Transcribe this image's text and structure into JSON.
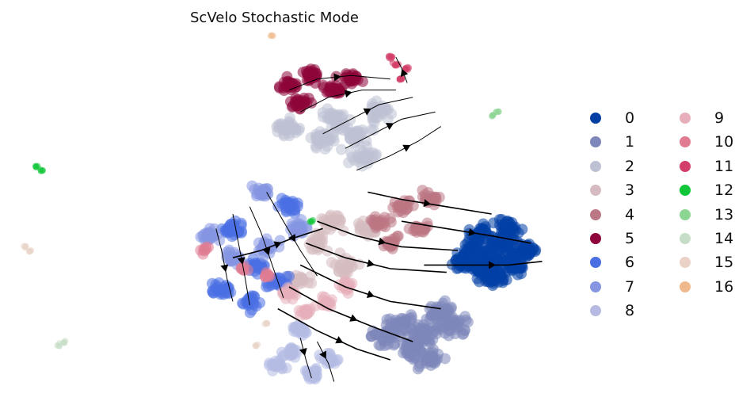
{
  "chart_data": {
    "type": "scatter",
    "title": "ScVelo Stochastic Mode",
    "xlabel": "",
    "ylabel": "",
    "grid": false,
    "legend_position": "right",
    "legend_entries": [
      {
        "label": "0",
        "color": "#023fa5"
      },
      {
        "label": "1",
        "color": "#7d87b9"
      },
      {
        "label": "2",
        "color": "#bec1d4"
      },
      {
        "label": "3",
        "color": "#d6bcc0"
      },
      {
        "label": "4",
        "color": "#bb7784"
      },
      {
        "label": "5",
        "color": "#8e063b"
      },
      {
        "label": "6",
        "color": "#4a6fe3"
      },
      {
        "label": "7",
        "color": "#8595e1"
      },
      {
        "label": "8",
        "color": "#b5bbe3"
      },
      {
        "label": "9",
        "color": "#e6afb9"
      },
      {
        "label": "10",
        "color": "#e07b91"
      },
      {
        "label": "11",
        "color": "#d33f6a"
      },
      {
        "label": "12",
        "color": "#11c638"
      },
      {
        "label": "13",
        "color": "#8dd593"
      },
      {
        "label": "14",
        "color": "#c6dec7"
      },
      {
        "label": "15",
        "color": "#ead3c6"
      },
      {
        "label": "16",
        "color": "#f0b98d"
      }
    ],
    "clusters": [
      {
        "label": "0",
        "points": [
          [
            0.83,
            0.4
          ],
          [
            0.86,
            0.38
          ],
          [
            0.88,
            0.42
          ],
          [
            0.9,
            0.36
          ],
          [
            0.87,
            0.33
          ],
          [
            0.84,
            0.44
          ],
          [
            0.92,
            0.4
          ],
          [
            0.89,
            0.46
          ],
          [
            0.85,
            0.35
          ],
          [
            0.81,
            0.37
          ]
        ]
      },
      {
        "label": "1",
        "points": [
          [
            0.7,
            0.2
          ],
          [
            0.74,
            0.17
          ],
          [
            0.77,
            0.23
          ],
          [
            0.72,
            0.13
          ],
          [
            0.79,
            0.19
          ],
          [
            0.67,
            0.16
          ],
          [
            0.75,
            0.1
          ]
        ]
      },
      {
        "label": "2",
        "points": [
          [
            0.5,
            0.74
          ],
          [
            0.56,
            0.7
          ],
          [
            0.62,
            0.72
          ],
          [
            0.66,
            0.78
          ],
          [
            0.58,
            0.76
          ],
          [
            0.63,
            0.66
          ]
        ]
      },
      {
        "label": "3",
        "points": [
          [
            0.55,
            0.42
          ],
          [
            0.6,
            0.36
          ],
          [
            0.64,
            0.46
          ],
          [
            0.52,
            0.32
          ],
          [
            0.58,
            0.48
          ]
        ]
      },
      {
        "label": "4",
        "points": [
          [
            0.66,
            0.48
          ],
          [
            0.7,
            0.52
          ],
          [
            0.73,
            0.46
          ],
          [
            0.68,
            0.42
          ],
          [
            0.75,
            0.54
          ]
        ]
      },
      {
        "label": "5",
        "points": [
          [
            0.5,
            0.85
          ],
          [
            0.54,
            0.88
          ],
          [
            0.58,
            0.84
          ],
          [
            0.52,
            0.8
          ],
          [
            0.61,
            0.87
          ]
        ]
      },
      {
        "label": "6",
        "points": [
          [
            0.38,
            0.29
          ],
          [
            0.43,
            0.26
          ],
          [
            0.48,
            0.31
          ],
          [
            0.44,
            0.36
          ],
          [
            0.4,
            0.46
          ],
          [
            0.5,
            0.52
          ]
        ]
      },
      {
        "label": "7",
        "points": [
          [
            0.36,
            0.44
          ],
          [
            0.4,
            0.38
          ],
          [
            0.46,
            0.41
          ],
          [
            0.52,
            0.46
          ],
          [
            0.45,
            0.56
          ]
        ]
      },
      {
        "label": "8",
        "points": [
          [
            0.5,
            0.12
          ],
          [
            0.54,
            0.06
          ],
          [
            0.52,
            0.18
          ],
          [
            0.57,
            0.1
          ],
          [
            0.48,
            0.08
          ]
        ]
      },
      {
        "label": "9",
        "points": [
          [
            0.53,
            0.23
          ],
          [
            0.5,
            0.28
          ],
          [
            0.56,
            0.26
          ],
          [
            0.6,
            0.3
          ]
        ]
      },
      {
        "label": "10",
        "points": [
          [
            0.42,
            0.35
          ],
          [
            0.46,
            0.33
          ],
          [
            0.35,
            0.4
          ]
        ]
      },
      {
        "label": "11",
        "points": [
          [
            0.69,
            0.91
          ],
          [
            0.71,
            0.9
          ],
          [
            0.7,
            0.87
          ],
          [
            0.68,
            0.93
          ]
        ]
      },
      {
        "label": "12",
        "points": [
          [
            0.05,
            0.63
          ],
          [
            0.06,
            0.62
          ],
          [
            0.54,
            0.48
          ]
        ]
      },
      {
        "label": "13",
        "points": [
          [
            0.86,
            0.77
          ],
          [
            0.87,
            0.78
          ]
        ]
      },
      {
        "label": "14",
        "points": [
          [
            0.1,
            0.15
          ],
          [
            0.09,
            0.14
          ]
        ]
      },
      {
        "label": "15",
        "points": [
          [
            0.03,
            0.41
          ],
          [
            0.04,
            0.4
          ],
          [
            0.46,
            0.2
          ],
          [
            0.44,
            0.14
          ]
        ]
      },
      {
        "label": "16",
        "points": [
          [
            0.47,
            0.99
          ]
        ]
      }
    ]
  }
}
